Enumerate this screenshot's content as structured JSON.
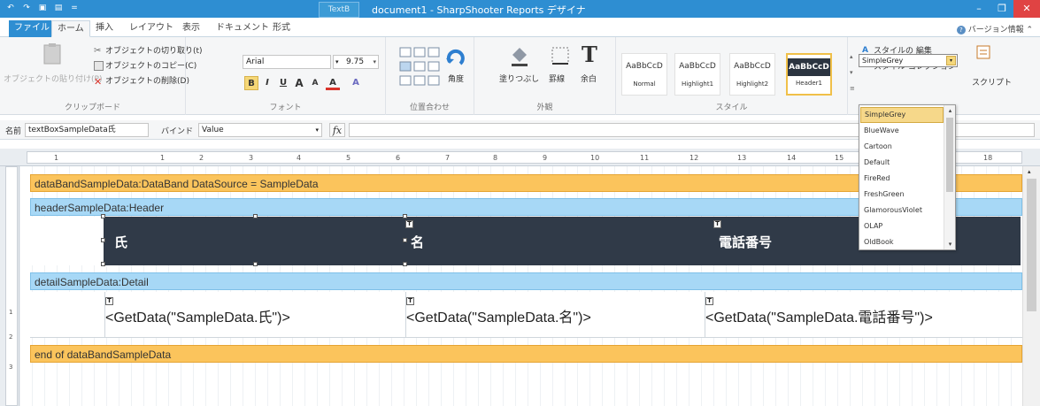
{
  "window": {
    "title": "document1 - SharpShooter Reports デザイナ",
    "context_tab": "TextB",
    "minimize": "–",
    "restore": "❐",
    "close": "✕"
  },
  "qat": [
    "↶",
    "↷",
    "▣",
    "▤",
    "="
  ],
  "tabs": {
    "file": "ファイル",
    "home": "ホーム",
    "insert": "挿入",
    "layout": "レイアウト",
    "view": "表示",
    "document": "ドキュメント",
    "format": "形式",
    "version_info": "バージョン情報"
  },
  "clipboard": {
    "paste": "オブジェクトの貼り付け(P)",
    "cut": "オブジェクトの切り取り(t)",
    "copy": "オブジェクトのコピー(C)",
    "delete": "オブジェクトの削除(D)",
    "label": "クリップボード"
  },
  "font": {
    "name": "Arial",
    "size": "9.75",
    "label": "フォント"
  },
  "align": {
    "angle": "角度",
    "label": "位置合わせ"
  },
  "appearance": {
    "fill": "塗りつぶし",
    "border": "罫線",
    "margin": "余白",
    "label": "外観"
  },
  "styles": {
    "items": [
      {
        "sample": "AaBbCcD",
        "name": "Normal"
      },
      {
        "sample": "AaBbCcD",
        "name": "Highlight1"
      },
      {
        "sample": "AaBbCcD",
        "name": "Highlight2"
      },
      {
        "sample": "AaBbCcD",
        "name": "Header1"
      }
    ],
    "edit": "スタイルの 編集",
    "collection": "スタイル コレクション",
    "label": "スタイル",
    "current": "SimpleGrey",
    "script": "スクリプト"
  },
  "namebar": {
    "name_label": "名前",
    "name_value": "textBoxSampleData氏",
    "bind_label": "バインド",
    "bind_value": "Value",
    "fx": "fx"
  },
  "ruler_h": [
    "1",
    "1",
    "2",
    "3",
    "4",
    "5",
    "6",
    "7",
    "8",
    "9",
    "10",
    "11",
    "12",
    "13",
    "14",
    "15",
    "18"
  ],
  "ruler_v": [
    "1",
    "2",
    "3"
  ],
  "report": {
    "data_band": "dataBandSampleData:DataBand   DataSource = SampleData",
    "header_band": "headerSampleData:Header",
    "header_cols": [
      "氏",
      "名",
      "電話番号"
    ],
    "detail_band": "detailSampleData:Detail",
    "detail_cols": [
      "<GetData(\"SampleData.氏\")>",
      "<GetData(\"SampleData.名\")>",
      "<GetData(\"SampleData.電話番号\")>"
    ],
    "end_band": "end of dataBandSampleData"
  },
  "style_dropdown": [
    "SimpleGrey",
    "BlueWave",
    "Cartoon",
    "Default",
    "FireRed",
    "FreshGreen",
    "GlamorousViolet",
    "OLAP",
    "OldBook"
  ],
  "colors": {
    "titlebar": "#2e8ed2",
    "band_orange": "#fbc45c",
    "band_blue": "#a7d8f6",
    "header_dark": "#303a48",
    "dropdown_selected": "#f6d88a"
  }
}
